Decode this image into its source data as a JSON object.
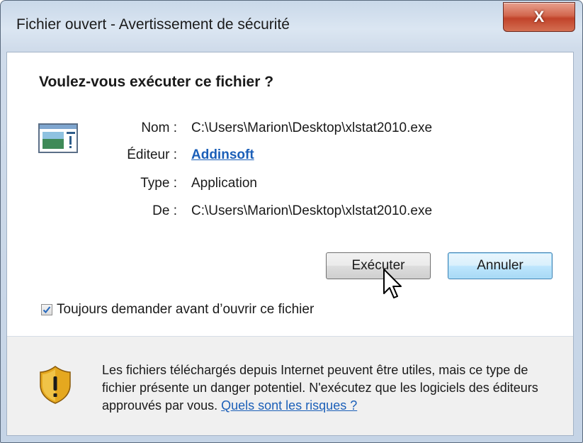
{
  "window": {
    "title": "Fichier ouvert - Avertissement de sécurité",
    "close_glyph": "X"
  },
  "dialog": {
    "heading": "Voulez-vous exécuter ce fichier ?",
    "file_icon": "application-window-icon",
    "fields": [
      {
        "label": "Nom :",
        "value": "C:\\Users\\Marion\\Desktop\\xlstat2010.exe"
      },
      {
        "label": "Éditeur :",
        "value": "Addinsoft",
        "is_link": true
      },
      {
        "label": "Type :",
        "value": "Application"
      },
      {
        "label": "De :",
        "value": "C:\\Users\\Marion\\Desktop\\xlstat2010.exe"
      }
    ],
    "buttons": {
      "run": "Exécuter",
      "cancel": "Annuler"
    },
    "checkbox": {
      "label": "Toujours demander avant d’ouvrir ce fichier",
      "checked": true
    }
  },
  "warning": {
    "icon": "shield-warning-icon",
    "text": "Les fichiers téléchargés depuis Internet peuvent être utiles, mais ce type de fichier présente un danger potentiel. N'exécutez que les logiciels des éditeurs approuvés par vous.",
    "link": "Quels sont les risques ?"
  },
  "colors": {
    "link": "#1b5fb8",
    "close_button": "#c1432a",
    "default_button": "#3c7fb1",
    "shield": "#e5a81f"
  }
}
